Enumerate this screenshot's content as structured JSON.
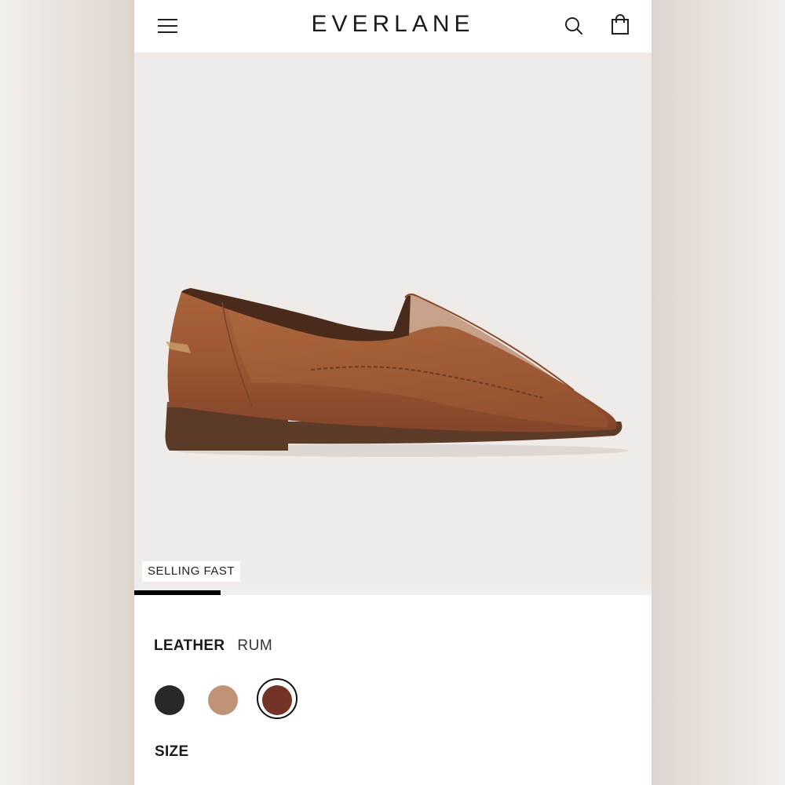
{
  "header": {
    "brand": "EVERLANE",
    "icons": [
      "menu-icon",
      "search-icon",
      "bag-icon"
    ]
  },
  "product": {
    "badge": "SELLING FAST",
    "gallery_progress": 0.167,
    "leather_label": "LEATHER",
    "selected_color": "RUM",
    "swatches": [
      {
        "color": "#26282a",
        "selected": false
      },
      {
        "color": "#c09376",
        "selected": false
      },
      {
        "color": "#733425",
        "selected": true
      }
    ],
    "size_label": "SIZE"
  }
}
